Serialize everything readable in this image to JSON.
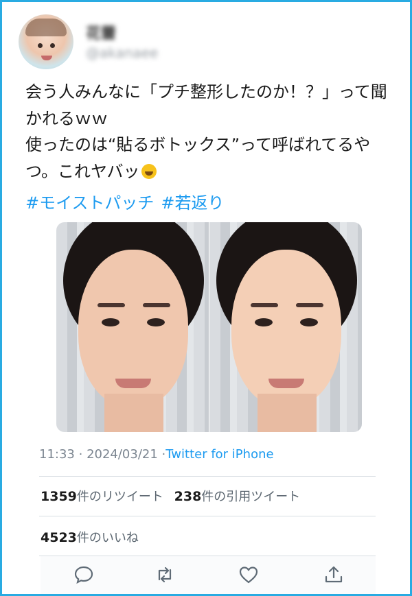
{
  "user": {
    "name": "花蕾",
    "handle": "@akanaee"
  },
  "tweet": {
    "text": "会う人みんなに「プチ整形したのか！？」って聞かれるｗｗ\n使ったのは“貼るボトックス”って呼ばれてるやつ。これヤバッ",
    "emoji": "rolling-on-the-floor-laughing",
    "hashtags": [
      "#モイストパッチ",
      "#若返り"
    ]
  },
  "meta": {
    "time": "11:33",
    "date": "2024/03/21",
    "client": "Twitter for iPhone"
  },
  "stats": {
    "retweets_count": "1359",
    "retweets_label": "件のリツイート",
    "quotes_count": "238",
    "quotes_label": "件の引用ツイート",
    "likes_count": "4523",
    "likes_label": "件のいいね"
  },
  "actions": {
    "icons": [
      "reply-icon",
      "retweet-icon",
      "like-icon",
      "share-icon"
    ]
  },
  "colors": {
    "frame_border": "#29abe2",
    "link": "#1d9bf0",
    "text": "#1a1a1a"
  }
}
